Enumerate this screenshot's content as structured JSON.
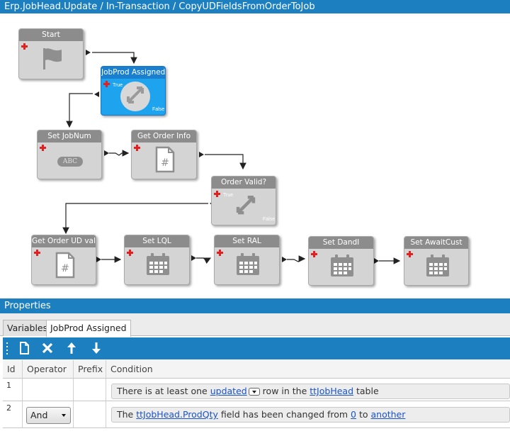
{
  "window": {
    "title": "Erp.JobHead.Update / In-Transaction / CopyUDFieldsFromOrderToJob"
  },
  "nodes": {
    "start": {
      "label": "Start"
    },
    "jobprod": {
      "label": "JobProd Assigned",
      "true_label": "True",
      "false_label": "False"
    },
    "setjobnum": {
      "label": "Set JobNum",
      "icon_text": "ABC"
    },
    "getorderinfo": {
      "label": "Get Order Info"
    },
    "ordervalid": {
      "label": "Order Valid?",
      "true_label": "True",
      "false_label": "False"
    },
    "getorderud": {
      "label": "Get Order UD vals"
    },
    "setlql": {
      "label": "Set LQL"
    },
    "setral": {
      "label": "Set RAL"
    },
    "setdandi": {
      "label": "Set DandI"
    },
    "setawait": {
      "label": "Set AwaitCust"
    }
  },
  "properties": {
    "title": "Properties",
    "tabs": [
      "Variables",
      "JobProd Assigned"
    ]
  },
  "grid": {
    "headers": [
      "Id",
      "Operator",
      "Prefix",
      "Condition"
    ],
    "rows": [
      {
        "id": "1",
        "operator": "",
        "c1": "There is at least one ",
        "c1_link": "updated",
        "c2": " row in the ",
        "c2_link": "ttJobHead",
        "c3": " table"
      },
      {
        "id": "2",
        "operator": "And",
        "c1": "The ",
        "c1_link": "ttJobHead.ProdQty",
        "c2": " field has been changed from ",
        "c2_link": "0",
        "c3": " to ",
        "c3_link": "another"
      }
    ]
  }
}
